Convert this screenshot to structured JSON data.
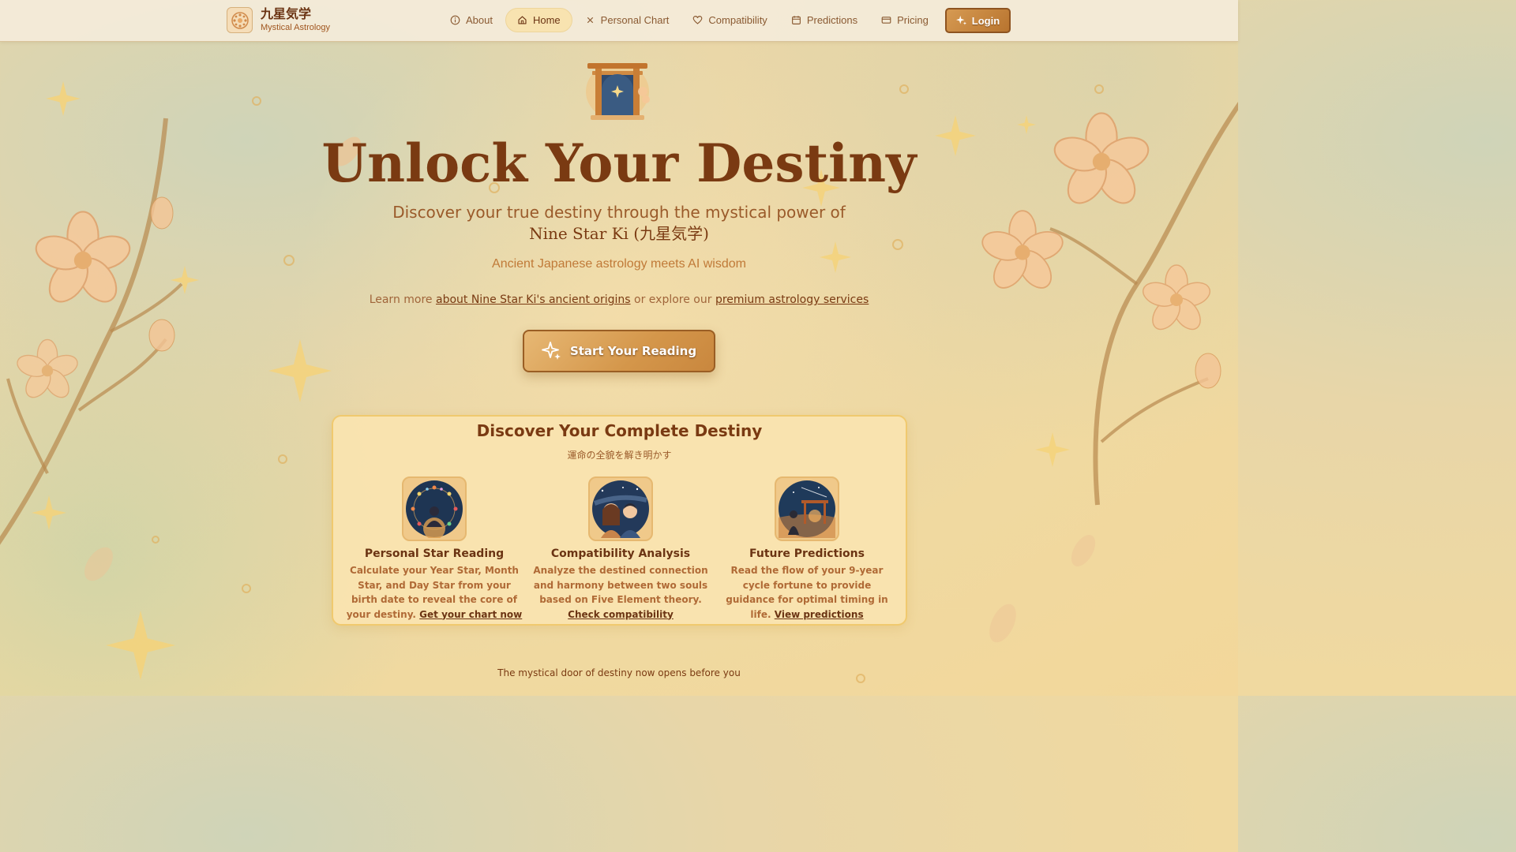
{
  "brand": {
    "title": "九星気学",
    "subtitle": "Mystical Astrology",
    "logo_icon": "nine-star-mandala-icon"
  },
  "nav": {
    "items": [
      {
        "label": "About",
        "icon": "info-icon",
        "active": false
      },
      {
        "label": "Home",
        "icon": "home-icon",
        "active": true
      },
      {
        "label": "Personal Chart",
        "icon": "close-x-icon",
        "active": false
      },
      {
        "label": "Compatibility",
        "icon": "heart-icon",
        "active": false
      },
      {
        "label": "Predictions",
        "icon": "calendar-icon",
        "active": false
      },
      {
        "label": "Pricing",
        "icon": "credit-card-icon",
        "active": false
      }
    ],
    "login_label": "Login"
  },
  "hero": {
    "title": "Unlock Your Destiny",
    "subtitle_line1": "Discover your true destiny through the mystical power of",
    "subtitle_line2": "Nine Star Ki (九星気学)",
    "tagline": "Ancient Japanese astrology meets AI wisdom",
    "learn_prefix": "Learn more ",
    "learn_link1": "about Nine Star Ki's ancient origins",
    "learn_middle": " or explore our ",
    "learn_link2": "premium astrology services",
    "cta_label": "Start Your Reading"
  },
  "destiny_card": {
    "title": "Discover Your Complete Destiny",
    "subtitle": "運命の全貌を解き明かす",
    "features": [
      {
        "title": "Personal Star Reading",
        "desc": "Calculate your Year Star, Month Star, and Day Star from your birth date to reveal the core of your destiny.",
        "link": "Get your chart now"
      },
      {
        "title": "Compatibility Analysis",
        "desc": "Analyze the destined connection and harmony between two souls based on Five Element theory.",
        "link": "Check compatibility"
      },
      {
        "title": "Future Predictions",
        "desc": "Read the flow of your 9-year cycle fortune to provide guidance for optimal timing in life.",
        "link": "View predictions"
      }
    ]
  },
  "footer": {
    "text": "The mystical door of destiny now opens before you"
  },
  "colors": {
    "primary_text": "#7a3a12",
    "accent": "#d4964a",
    "card_bg": "#fae4b0",
    "card_border": "#f0c96e"
  }
}
